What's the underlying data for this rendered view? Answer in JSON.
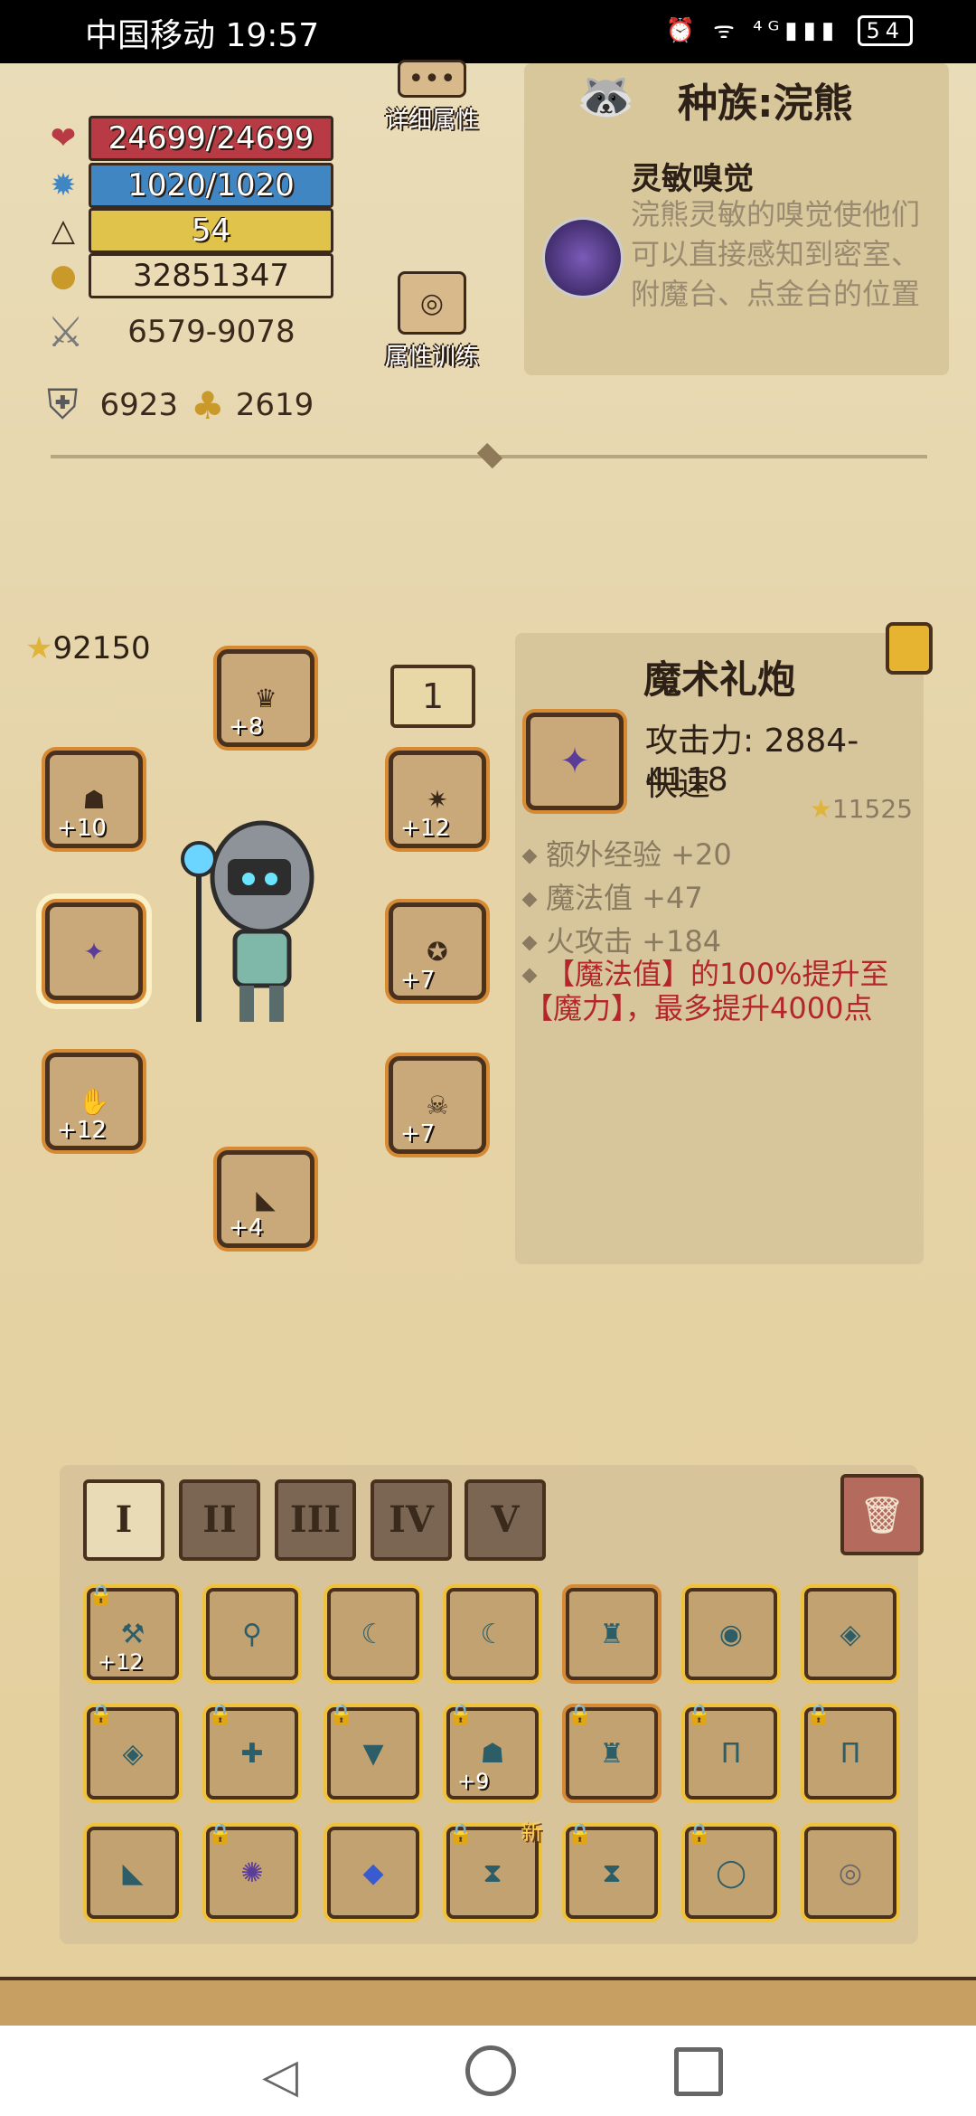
{
  "status": {
    "carrier_time": "中国移动 19:57",
    "network_icons": "⏰ ᯤ ⁴ᴳ▮▮▮",
    "battery": "54"
  },
  "stats": {
    "hp": "24699/24699",
    "mp": "1020/1020",
    "level": "54",
    "gold": "32851347",
    "damage": "6579-9078",
    "defense": "6923",
    "other": "2619"
  },
  "buttons": {
    "detail_attributes": "详细属性",
    "attribute_training": "属性训练"
  },
  "race": {
    "title": "种族:浣熊",
    "skill_title": "灵敏嗅觉",
    "skill_desc": "浣熊灵敏的嗅觉使他们可以直接感知到密室、附魔台、点金台的位置"
  },
  "equipment": {
    "gear_score": "92150",
    "level_badge": "1",
    "slots": {
      "helmet_plus": "+8",
      "shoulder_left_plus": "+10",
      "shoulder_right_plus": "+12",
      "amulet_plus": "+7",
      "glove_plus": "+12",
      "boots_plus": "+4",
      "ring_plus": "+7"
    }
  },
  "item": {
    "name": "魔术礼炮",
    "attack": "攻击力: 2884-4118",
    "speed": "快速",
    "score": "11525",
    "bonuses": [
      "额外经验 +20",
      "魔法值 +47",
      "火攻击 +184"
    ],
    "special": "【魔法值】的100%提升至【魔力】，最多提升4000点"
  },
  "inventory": {
    "tabs": [
      "I",
      "II",
      "III",
      "IV",
      "V"
    ],
    "row1_plus": "+12",
    "row2_plus": "+9",
    "new_badge": "新"
  },
  "colors": {
    "hp": "#b83a44",
    "mp": "#3f86c3",
    "level": "#e0c34a",
    "special_text": "#b3262c"
  }
}
